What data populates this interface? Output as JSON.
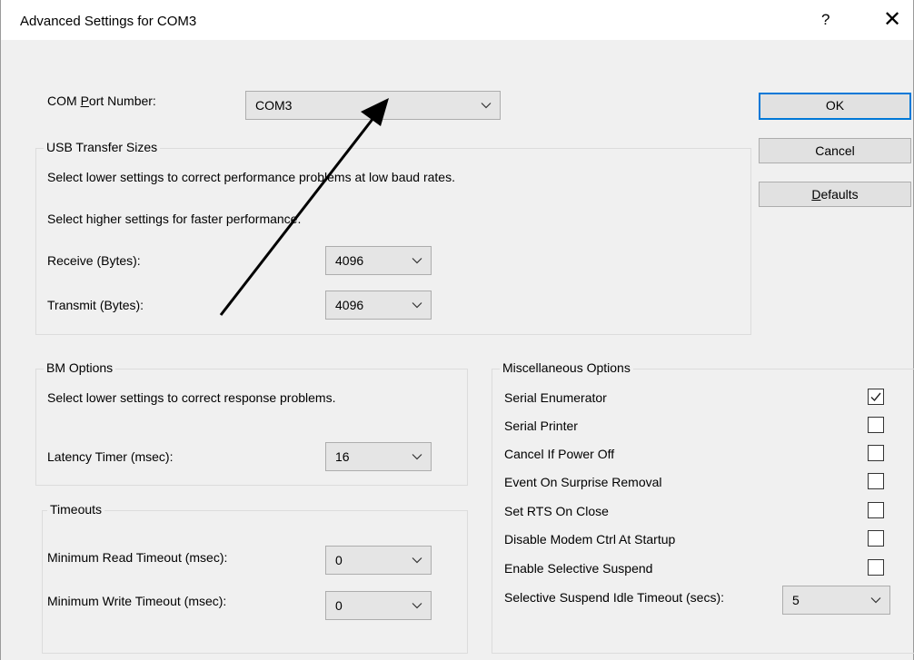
{
  "window": {
    "title": "Advanced Settings for COM3",
    "help_label": "?",
    "close_label": "✕"
  },
  "com_port": {
    "label_pre": "COM ",
    "label_u": "P",
    "label_post": "ort Number:",
    "value": "COM3"
  },
  "buttons": {
    "ok": "OK",
    "cancel": "Cancel",
    "defaults_u": "D",
    "defaults_rest": "efaults"
  },
  "usb": {
    "legend": "USB Transfer Sizes",
    "line1": "Select lower settings to correct performance problems at low baud rates.",
    "line2": "Select higher settings for faster performance.",
    "receive_label": "Receive (Bytes):",
    "receive_value": "4096",
    "transmit_label": "Transmit (Bytes):",
    "transmit_value": "4096"
  },
  "bm": {
    "legend": "BM Options",
    "line1": "Select lower settings to correct response problems.",
    "latency_label": "Latency Timer (msec):",
    "latency_value": "16"
  },
  "timeouts": {
    "legend": "Timeouts",
    "read_label": "Minimum Read Timeout (msec):",
    "read_value": "0",
    "write_label": "Minimum Write Timeout (msec):",
    "write_value": "0"
  },
  "misc": {
    "legend": "Miscellaneous Options",
    "options": [
      {
        "label": "Serial Enumerator",
        "checked": true
      },
      {
        "label": "Serial Printer",
        "checked": false
      },
      {
        "label": "Cancel If Power Off",
        "checked": false
      },
      {
        "label": "Event On Surprise Removal",
        "checked": false
      },
      {
        "label": "Set RTS On Close",
        "checked": false
      },
      {
        "label": "Disable Modem Ctrl At Startup",
        "checked": false
      },
      {
        "label": "Enable Selective Suspend",
        "checked": false
      }
    ],
    "idle_label": "Selective Suspend Idle Timeout (secs):",
    "idle_value": "5"
  },
  "colors": {
    "accent": "#0078d7",
    "annotation_arrow": "#000000"
  }
}
